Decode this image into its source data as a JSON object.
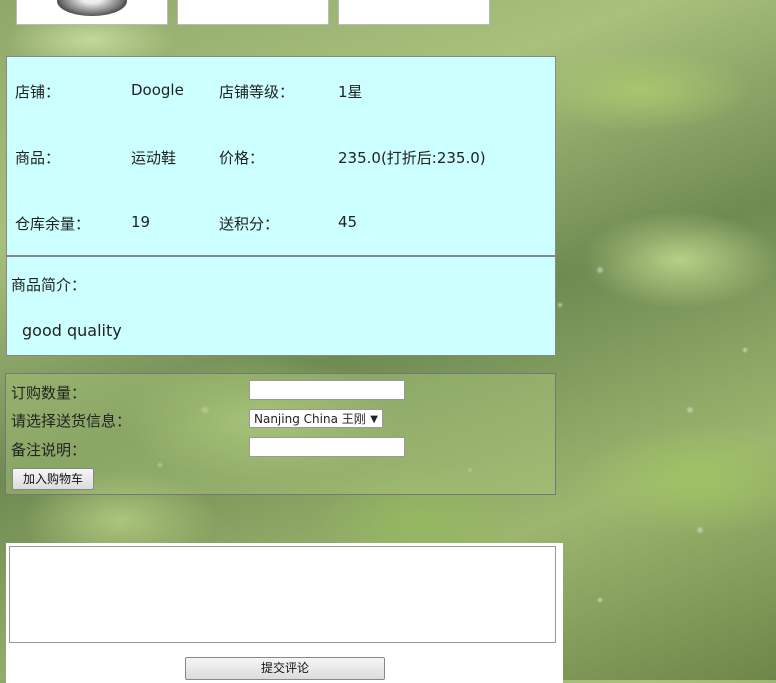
{
  "info": {
    "shop_label": "店铺：",
    "shop_value": "Doogle",
    "level_label": "店铺等级：",
    "level_value": "1星",
    "product_label": "商品：",
    "product_value": "运动鞋",
    "price_label": "价格：",
    "price_value": "235.0(打折后:235.0)",
    "stock_label": "仓库余量：",
    "stock_value": "19",
    "points_label": "送积分：",
    "points_value": "45"
  },
  "description": {
    "label": "商品简介：",
    "text": "good quality"
  },
  "order": {
    "quantity_label": "订购数量：",
    "quantity_value": "",
    "delivery_label": "请选择送货信息：",
    "delivery_selected": "Nanjing China 王刚",
    "note_label": "备注说明：",
    "note_value": "",
    "add_to_cart": "加入购物车"
  },
  "comment": {
    "text": "",
    "submit": "提交评论"
  }
}
